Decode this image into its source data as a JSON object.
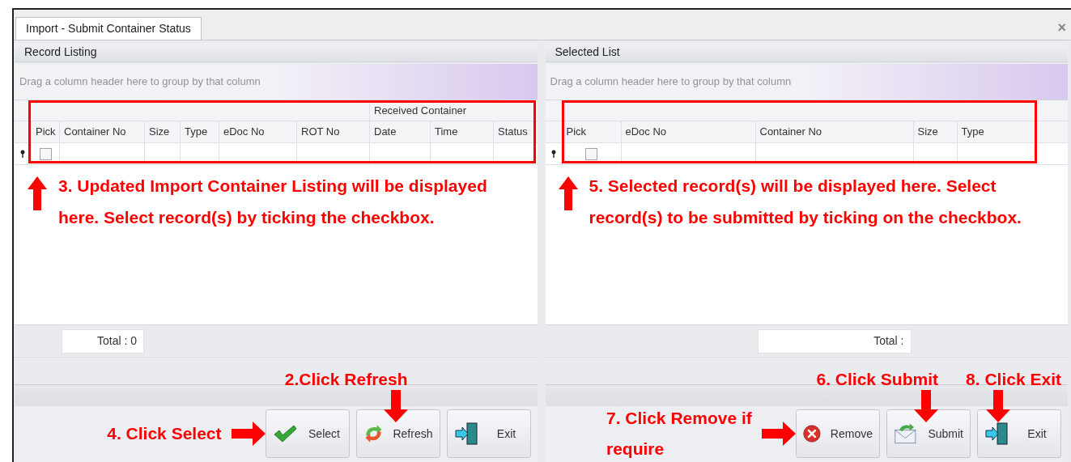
{
  "window": {
    "tabs": [
      {
        "label": "Import - Submit Container Status",
        "selected": true
      }
    ],
    "close": "×"
  },
  "panels": [
    {
      "title": "Record Listing",
      "group_hint": "Drag a column header here to group by that column",
      "highlighted": true,
      "columns": [
        {
          "label": "Pick"
        },
        {
          "label": "Container No"
        },
        {
          "label": "Size"
        },
        {
          "label": "Type"
        },
        {
          "label": "eDoc No"
        },
        {
          "label": "ROT No"
        },
        {
          "band": "Received Container",
          "columns": [
            {
              "label": "Date"
            },
            {
              "label": "Time"
            },
            {
              "label": "Status"
            }
          ]
        }
      ],
      "new_row": {
        "checked": false
      },
      "note": "3. Updated Import Container Listing will be displayed here. Select record(s) by ticking the checkbox.",
      "total": "Total : 0",
      "buttons": [
        {
          "label": "Select",
          "kind": "check",
          "step": {
            "text": "4. Click Select",
            "kind": "left"
          }
        },
        {
          "label": "Refresh",
          "kind": "refresh",
          "step": {
            "text": "2.Click Refresh",
            "kind": "above"
          }
        },
        {
          "label": "Exit",
          "kind": "exit"
        }
      ]
    },
    {
      "title": "Selected List",
      "group_hint": "Drag a column header here to group by that column",
      "highlighted": true,
      "columns": [
        {
          "label": "Pick"
        },
        {
          "label": "eDoc No"
        },
        {
          "label": "Container No"
        },
        {
          "label": "Size"
        },
        {
          "label": "Type"
        }
      ],
      "new_row": {
        "checked": false
      },
      "note": "5. Selected record(s) will be displayed here. Select record(s) to be submitted by ticking on the checkbox.",
      "total": "Total :",
      "buttons": [
        {
          "label": "Remove",
          "kind": "remove",
          "step": {
            "text": "7. Click Remove if require",
            "kind": "left"
          }
        },
        {
          "label": "Submit",
          "kind": "submit",
          "step": {
            "text": "6. Click Submit",
            "kind": "above"
          }
        },
        {
          "label": "Exit",
          "kind": "exit",
          "step": {
            "text": "8. Click Exit",
            "kind": "above"
          }
        }
      ]
    }
  ]
}
